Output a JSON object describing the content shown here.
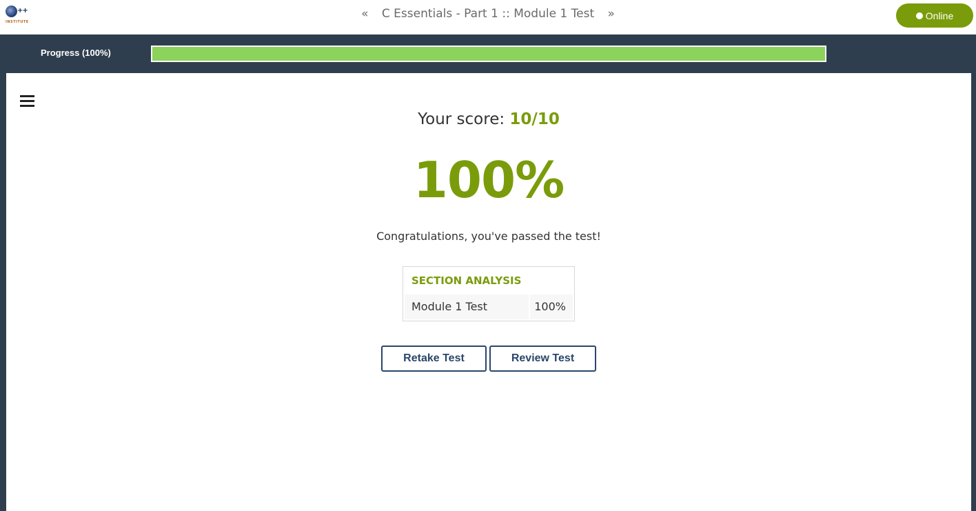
{
  "header": {
    "logo": {
      "plus": "++",
      "subtitle": "INSTITUTE"
    },
    "prev_icon": "double-chevron-left-icon",
    "next_icon": "double-chevron-right-icon",
    "prev_glyph": "«",
    "next_glyph": "»",
    "title": "C Essentials - Part 1 :: Module 1 Test",
    "status_label": "Online"
  },
  "progress": {
    "label": "Progress (100%)",
    "value_percent": 100,
    "colors": {
      "fill": "#8bd35b",
      "track": "#ffffff"
    }
  },
  "menu_icon": "hamburger-menu-icon",
  "result": {
    "score_prefix": "Your score:",
    "score_value": "10/10",
    "percent": "100%",
    "message": "Congratulations, you've passed the test!"
  },
  "section_analysis": {
    "heading": "SECTION ANALYSIS",
    "rows": [
      {
        "name": "Module 1 Test",
        "value": "100%"
      }
    ]
  },
  "actions": {
    "retake_label": "Retake Test",
    "review_label": "Review Test"
  },
  "colors": {
    "accent": "#7a9c0b",
    "frame": "#2f3e4e",
    "button_border": "#2a4669"
  }
}
